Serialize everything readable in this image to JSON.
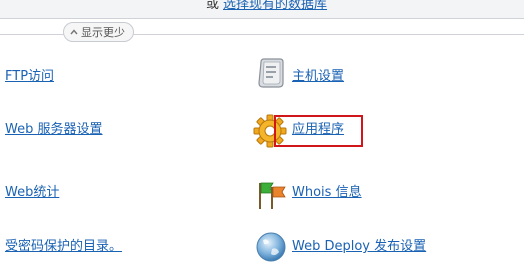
{
  "top": {
    "or_text": "或",
    "select_link": "选择现有的数据库"
  },
  "toggle": {
    "label": "显示更少",
    "icon": "chevron-up-icon"
  },
  "left_links": [
    {
      "label": "FTP访问"
    },
    {
      "label": "Web 服务器设置"
    },
    {
      "label": "Web统计"
    },
    {
      "label": "受密码保护的目录。"
    }
  ],
  "right_links": [
    {
      "label": "主机设置",
      "icon": "host-settings-icon"
    },
    {
      "label": "应用程序",
      "icon": "gear-icon"
    },
    {
      "label": "Whois 信息",
      "icon": "flags-icon"
    },
    {
      "label": "Web Deploy 发布设置",
      "icon": "globe-icon"
    }
  ],
  "colors": {
    "link": "#1a62b3",
    "highlight": "#d0161b"
  }
}
